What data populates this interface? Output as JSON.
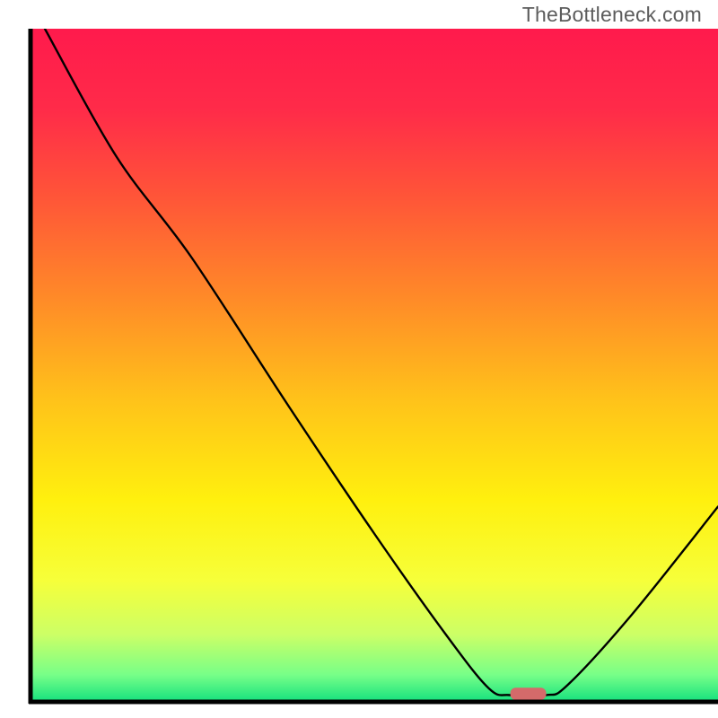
{
  "watermark": "TheBottleneck.com",
  "chart_data": {
    "type": "line",
    "title": "",
    "xlabel": "",
    "ylabel": "",
    "xlim": [
      0,
      100
    ],
    "ylim": [
      0,
      100
    ],
    "gradient_stops": [
      {
        "offset": 0.0,
        "color": "#ff1a4c"
      },
      {
        "offset": 0.12,
        "color": "#ff2b49"
      },
      {
        "offset": 0.25,
        "color": "#ff5538"
      },
      {
        "offset": 0.4,
        "color": "#ff8a28"
      },
      {
        "offset": 0.55,
        "color": "#ffc21a"
      },
      {
        "offset": 0.7,
        "color": "#fff00e"
      },
      {
        "offset": 0.82,
        "color": "#f6ff3a"
      },
      {
        "offset": 0.9,
        "color": "#ccff66"
      },
      {
        "offset": 0.96,
        "color": "#77ff88"
      },
      {
        "offset": 1.0,
        "color": "#14e07e"
      }
    ],
    "curve_points": [
      {
        "x": 6.0,
        "y": 100.0
      },
      {
        "x": 16.0,
        "y": 81.0
      },
      {
        "x": 26.5,
        "y": 66.0
      },
      {
        "x": 40.0,
        "y": 44.0
      },
      {
        "x": 52.0,
        "y": 25.0
      },
      {
        "x": 62.0,
        "y": 10.0
      },
      {
        "x": 68.0,
        "y": 2.0
      },
      {
        "x": 71.0,
        "y": 1.0
      },
      {
        "x": 76.0,
        "y": 1.0
      },
      {
        "x": 79.0,
        "y": 2.5
      },
      {
        "x": 88.0,
        "y": 13.0
      },
      {
        "x": 100.0,
        "y": 29.0
      }
    ],
    "marker": {
      "x_center": 73.5,
      "y_center": 1.2,
      "width": 5.0,
      "height": 1.8,
      "color": "#d46a6a"
    },
    "axes": {
      "left_x": 4.0,
      "right_x": 100.0,
      "bottom_y": 0.0,
      "top_y": 100.0
    }
  }
}
